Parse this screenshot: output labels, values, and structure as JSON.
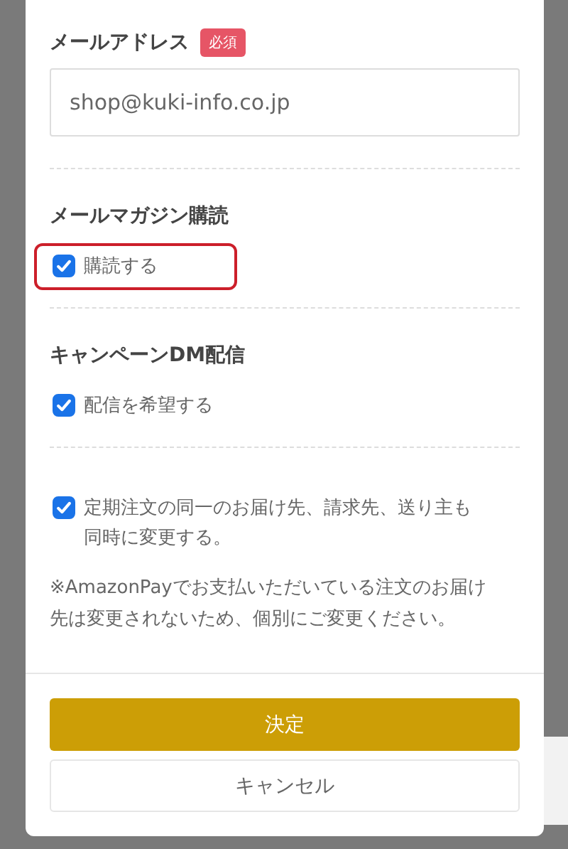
{
  "email": {
    "label": "メールアドレス",
    "required_badge": "必須",
    "value": "shop@kuki-info.co.jp"
  },
  "sections": [
    {
      "title": "メールマガジン購読",
      "options": [
        {
          "label": "購読する",
          "checked": true,
          "highlighted": true
        }
      ]
    },
    {
      "title": "キャンペーンDM配信",
      "options": [
        {
          "label": "配信を希望する",
          "checked": true,
          "highlighted": false
        }
      ]
    },
    {
      "options": [
        {
          "label": "定期注文の同一のお届け先、請求先、送り主も同時に変更する。",
          "checked": true,
          "highlighted": false
        }
      ],
      "note": "※AmazonPayでお支払いただいている注文のお届け先は変更されないため、個別にご変更ください。"
    }
  ],
  "buttons": [
    {
      "label": "決定",
      "kind": "primary"
    },
    {
      "label": "キャンセル",
      "kind": "secondary"
    }
  ]
}
